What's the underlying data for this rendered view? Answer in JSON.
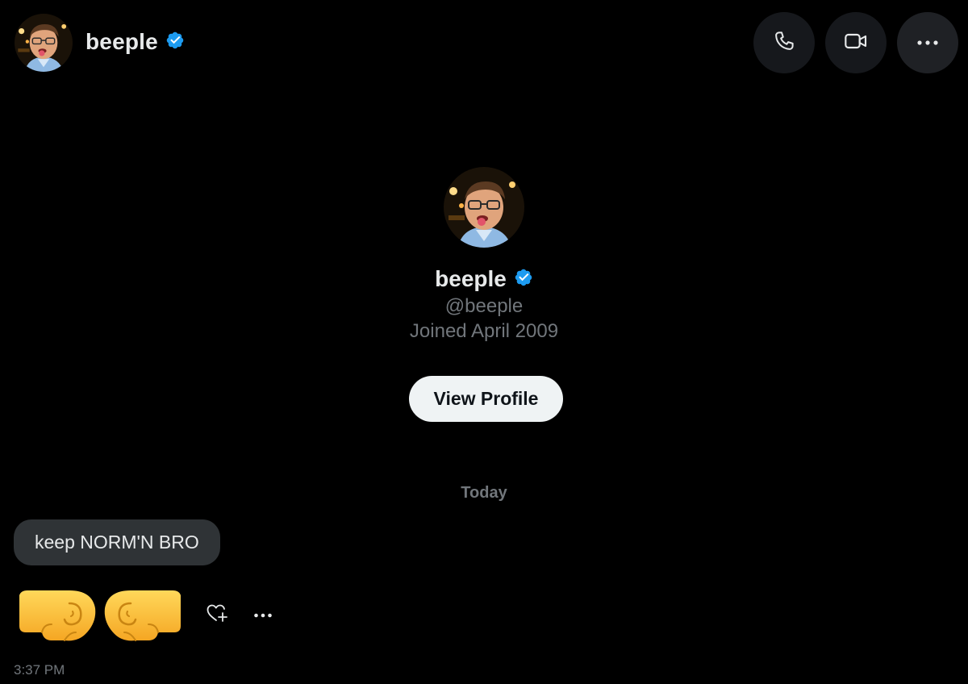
{
  "header": {
    "display_name": "beeple",
    "verified": true,
    "actions": [
      "phone-call",
      "video-call",
      "more-options"
    ]
  },
  "profile": {
    "display_name": "beeple",
    "handle": "@beeple",
    "joined": "Joined April 2009",
    "view_profile_label": "View Profile"
  },
  "conversation": {
    "date_divider": "Today",
    "messages": [
      {
        "text": "keep NORM'N BRO"
      },
      {
        "emoji": "left-facing-fist + right-facing-fist",
        "timestamp": "3:37 PM"
      }
    ]
  },
  "colors": {
    "background": "#000000",
    "primary_text": "#e7e9ea",
    "secondary_text": "#71767b",
    "verified_badge": "#1d9bf0",
    "bubble": "#2f3336",
    "button_light": "#eff3f4"
  }
}
